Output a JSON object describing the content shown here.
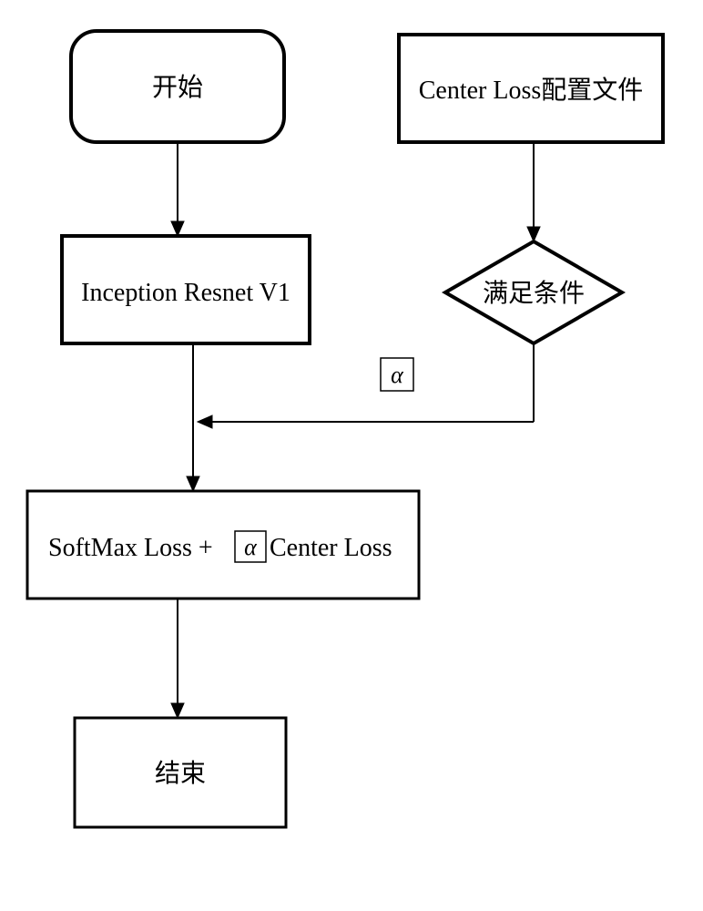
{
  "nodes": {
    "start": "开始",
    "config": "Center Loss配置文件",
    "inception": "Inception Resnet V1",
    "condition": "满足条件",
    "alpha_label": "α",
    "loss_prefix": "SoftMax Loss +",
    "loss_alpha": "α",
    "loss_suffix": " Center Loss",
    "end": "结束"
  }
}
